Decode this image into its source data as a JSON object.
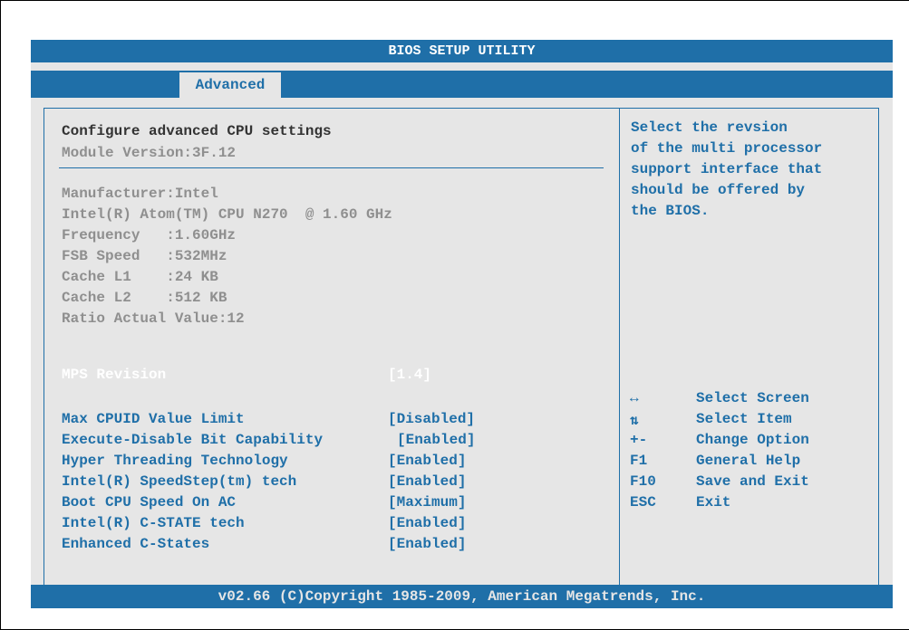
{
  "title": "BIOS SETUP UTILITY",
  "tabs": [
    {
      "label": "Advanced",
      "active": true
    }
  ],
  "left": {
    "heading": "Configure advanced CPU settings",
    "module_version": "Module Version:3F.12",
    "info": [
      "Manufacturer:Intel",
      "Intel(R) Atom(TM) CPU N270  @ 1.60 GHz",
      "Frequency   :1.60GHz",
      "FSB Speed   :532MHz",
      "Cache L1    :24 KB",
      "Cache L2    :512 KB",
      "Ratio Actual Value:12"
    ],
    "selected_option": {
      "label": "MPS Revision",
      "value": "[1.4]"
    },
    "options": [
      {
        "label": "Max CPUID Value Limit",
        "value": "[Disabled]"
      },
      {
        "label": "Execute-Disable Bit Capability",
        "value": "[Enabled]"
      },
      {
        "label": "Hyper Threading Technology",
        "value": "[Enabled]"
      },
      {
        "label": "Intel(R) SpeedStep(tm) tech",
        "value": "[Enabled]"
      },
      {
        "label": "Boot CPU Speed On AC",
        "value": "[Maximum]"
      },
      {
        "label": "Intel(R) C-STATE tech",
        "value": "[Enabled]"
      },
      {
        "label": "Enhanced C-States",
        "value": "[Enabled]"
      }
    ]
  },
  "help_text": "Select the revsion\nof the multi processor\nsupport interface that\nshould be offered by\nthe BIOS.",
  "keys": [
    {
      "key": "↔",
      "desc": "Select Screen"
    },
    {
      "key": "⇅",
      "desc": "Select Item"
    },
    {
      "key": "+-",
      "desc": "Change Option"
    },
    {
      "key": "F1",
      "desc": "General Help"
    },
    {
      "key": "F10",
      "desc": "Save and Exit"
    },
    {
      "key": "ESC",
      "desc": "Exit"
    }
  ],
  "footer": "v02.66 (C)Copyright 1985-2009, American Megatrends, Inc.",
  "colors": {
    "accent": "#1f6fa8",
    "background": "#e6e6e6",
    "dim_text": "#8f8f8f"
  }
}
